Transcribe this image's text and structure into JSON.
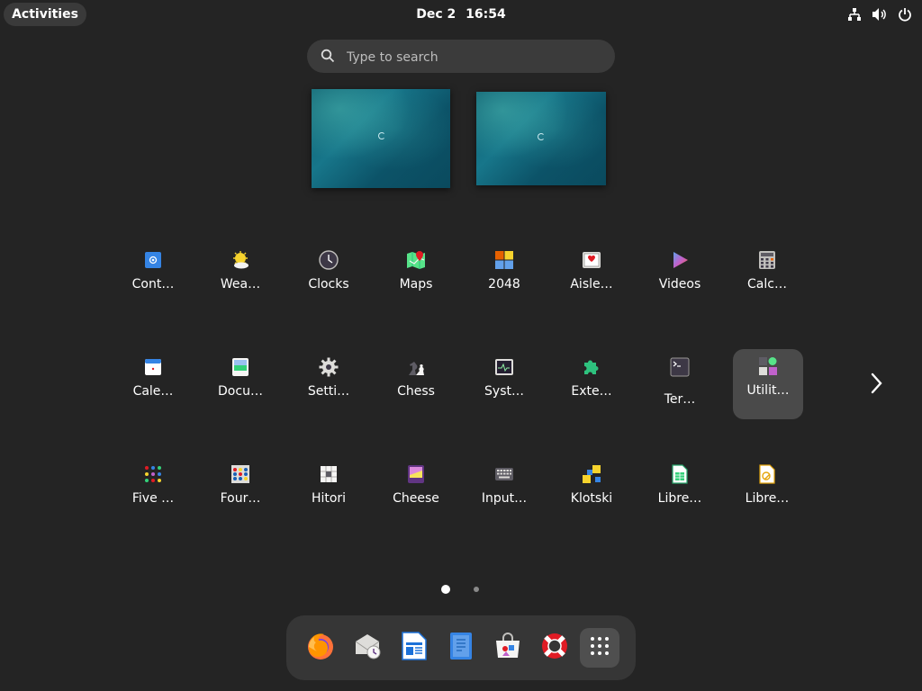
{
  "topbar": {
    "activities_label": "Activities",
    "date": "Dec 2",
    "time": "16:54"
  },
  "search": {
    "placeholder": "Type to search"
  },
  "apps": [
    {
      "label": "Cont…",
      "icon": "contacts-icon"
    },
    {
      "label": "Wea…",
      "icon": "weather-icon"
    },
    {
      "label": "Clocks",
      "icon": "clocks-icon"
    },
    {
      "label": "Maps",
      "icon": "maps-icon"
    },
    {
      "label": "2048",
      "icon": "game-2048-icon"
    },
    {
      "label": "Aisle…",
      "icon": "aisleriot-cards-icon"
    },
    {
      "label": "Videos",
      "icon": "videos-icon"
    },
    {
      "label": "Calc…",
      "icon": "calculator-icon"
    },
    {
      "label": "Cale…",
      "icon": "calendar-icon"
    },
    {
      "label": "Docu…",
      "icon": "document-viewer-icon"
    },
    {
      "label": "Setti…",
      "icon": "settings-gear-icon"
    },
    {
      "label": "Chess",
      "icon": "chess-icon"
    },
    {
      "label": "Syst…",
      "icon": "system-monitor-icon"
    },
    {
      "label": "Exte…",
      "icon": "extensions-puzzle-icon"
    },
    {
      "label": "Ter…",
      "icon": "terminal-icon"
    },
    {
      "label": "Utilit…",
      "icon": "utilities-folder-icon"
    },
    {
      "label": "Five …",
      "icon": "five-or-more-icon"
    },
    {
      "label": "Four…",
      "icon": "four-in-a-row-icon"
    },
    {
      "label": "Hitori",
      "icon": "hitori-icon"
    },
    {
      "label": "Cheese",
      "icon": "cheese-icon"
    },
    {
      "label": "Input…",
      "icon": "input-keyboard-icon"
    },
    {
      "label": "Klotski",
      "icon": "klotski-icon"
    },
    {
      "label": "Libre…",
      "icon": "libreoffice-calc-icon"
    },
    {
      "label": "Libre…",
      "icon": "libreoffice-draw-icon"
    }
  ],
  "pages": {
    "count": 2,
    "current": 1
  },
  "dock": [
    {
      "icon": "firefox-icon"
    },
    {
      "icon": "evolution-mail-icon"
    },
    {
      "icon": "libreoffice-writer-icon"
    },
    {
      "icon": "text-editor-icon"
    },
    {
      "icon": "software-store-icon"
    },
    {
      "icon": "help-lifebuoy-icon"
    },
    {
      "icon": "show-apps-grid-icon"
    }
  ],
  "colors": {
    "background": "#242424",
    "highlight": "#4a4a4a",
    "accent_blue": "#3584e4"
  }
}
